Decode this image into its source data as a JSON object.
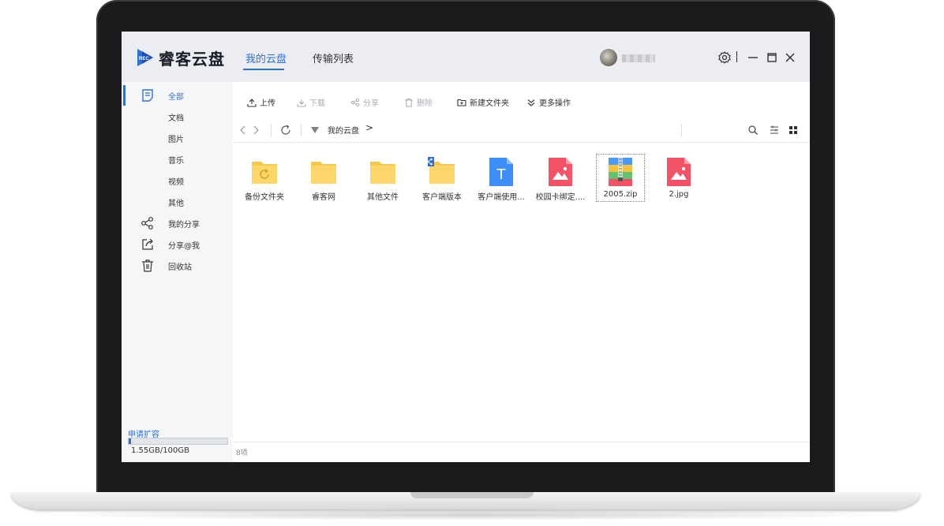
{
  "app": {
    "name": "睿客云盘",
    "logo_text": "REC"
  },
  "header": {
    "tabs": [
      {
        "label": "我的云盘",
        "active": true
      },
      {
        "label": "传输列表",
        "active": false
      }
    ],
    "icons": [
      "settings-icon",
      "minimize-icon",
      "maximize-icon",
      "close-icon"
    ]
  },
  "sidebar": {
    "items": [
      {
        "label": "全部",
        "icon": "document-icon",
        "active": true
      },
      {
        "label": "文档"
      },
      {
        "label": "图片"
      },
      {
        "label": "音乐"
      },
      {
        "label": "视频"
      },
      {
        "label": "其他"
      },
      {
        "label": "我的分享",
        "icon": "share-icon"
      },
      {
        "label": "分享@我",
        "icon": "share-to-me-icon"
      },
      {
        "label": "回收站",
        "icon": "trash-icon"
      }
    ],
    "expand_label": "申请扩容",
    "quota_text": "1.55GB/100GB",
    "quota_used_fraction": 0.0155
  },
  "toolbar": {
    "upload": "上传",
    "download": "下载",
    "share": "分享",
    "delete": "删除",
    "new_folder": "新建文件夹",
    "more": "更多操作"
  },
  "breadcrumb": {
    "root": "我的云盘",
    "separator": ">"
  },
  "files": [
    {
      "name": "备份文件夹",
      "type": "folder-backup"
    },
    {
      "name": "睿客网",
      "type": "folder"
    },
    {
      "name": "其他文件",
      "type": "folder"
    },
    {
      "name": "客户端版本",
      "type": "folder-shared"
    },
    {
      "name": "客户端使用...",
      "type": "text"
    },
    {
      "name": "校园卡绑定....",
      "type": "image"
    },
    {
      "name": "2005.zip",
      "type": "zip",
      "selected": true
    },
    {
      "name": "2.jpg",
      "type": "image"
    }
  ],
  "status": {
    "count": "8项"
  },
  "colors": {
    "accent": "#2f6fd8",
    "folder": "#fcd66a",
    "image": "#f45267",
    "text_file": "#3d8ef7"
  }
}
